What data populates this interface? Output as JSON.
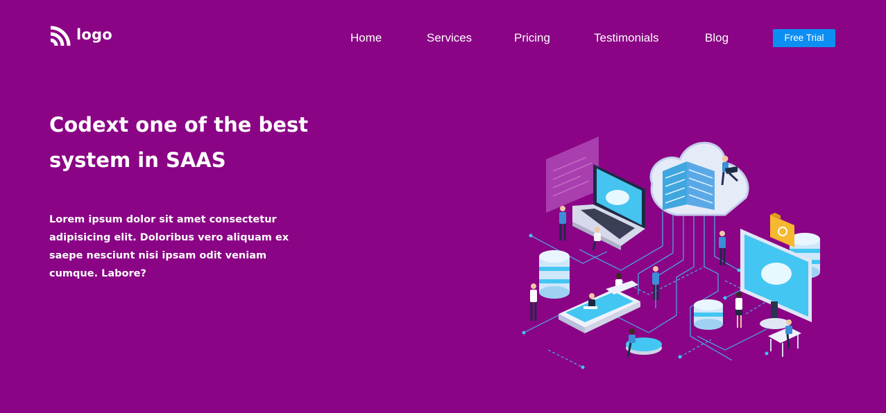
{
  "brand": {
    "logo_icon": "rss-feed-icon",
    "name": "logo"
  },
  "nav": {
    "items": [
      {
        "label": "Home"
      },
      {
        "label": "Services"
      },
      {
        "label": "Pricing"
      },
      {
        "label": "Testimonials"
      },
      {
        "label": "Blog"
      }
    ],
    "cta_label": "Free Trial"
  },
  "hero": {
    "title_line1": "Codext one of the best",
    "title_line2": "system in SAAS",
    "body_lines": [
      "Lorem ipsum dolor sit amet consectetur",
      "adipisicing elit. Doloribus vero aliquam ex",
      "saepe nesciunt nisi ipsam odit veniam",
      "cumque. Labore?"
    ],
    "illustration": "isometric-cloud-saas-network-illustration"
  },
  "colors": {
    "background": "#8a0485",
    "text": "#ffffff",
    "cta_background": "#0d8ef3",
    "illustration_accent": "#3fc8f0"
  }
}
